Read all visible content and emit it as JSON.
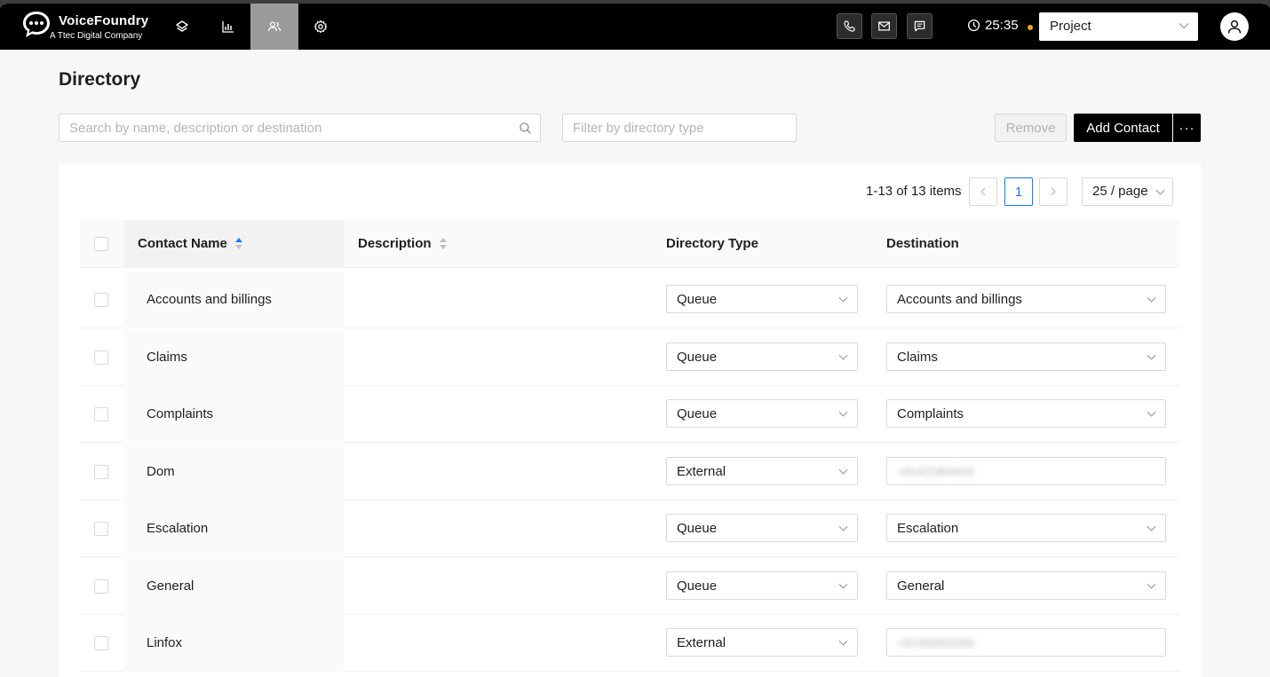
{
  "app": {
    "name": "VoiceFoundry",
    "tagline": "A Ttec Digital Company",
    "timer": "25:35",
    "project_label": "Project"
  },
  "page": {
    "title": "Directory",
    "search_placeholder": "Search by name, description or destination",
    "filter_placeholder": "Filter by directory type",
    "remove_label": "Remove",
    "add_label": "Add Contact",
    "more_label": "···"
  },
  "pagination": {
    "summary": "1-13 of 13 items",
    "current_page": "1",
    "page_size": "25 / page"
  },
  "table": {
    "columns": {
      "name": "Contact Name",
      "description": "Description",
      "type": "Directory Type",
      "destination": "Destination"
    },
    "rows": [
      {
        "name": "Accounts and billings",
        "type": "Queue",
        "destination": "Accounts and billings"
      },
      {
        "name": "Claims",
        "type": "Queue",
        "destination": "Claims"
      },
      {
        "name": "Complaints",
        "type": "Queue",
        "destination": "Complaints"
      },
      {
        "name": "Dom",
        "type": "External",
        "destination": "+61421904425"
      },
      {
        "name": "Escalation",
        "type": "Queue",
        "destination": "Escalation"
      },
      {
        "name": "General",
        "type": "Queue",
        "destination": "General"
      },
      {
        "name": "Linfox",
        "type": "External",
        "destination": "+61393401000"
      }
    ]
  },
  "colors": {
    "topbar": "#000000",
    "active_nav": "#9a9a9a",
    "accent": "#1677ff",
    "status_dot": "#f2a51a"
  }
}
